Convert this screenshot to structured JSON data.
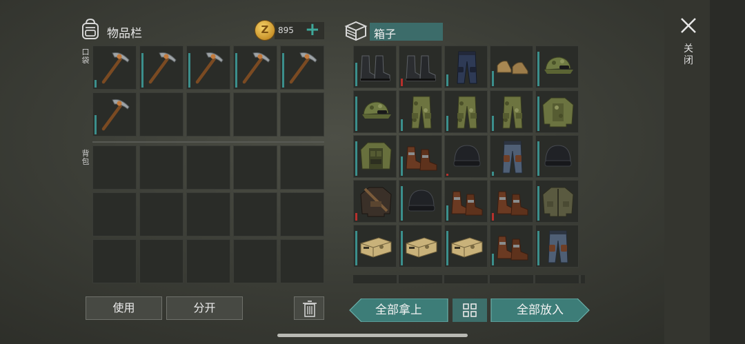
{
  "inventory": {
    "title": "物品栏",
    "pocket_label": "口袋",
    "backpack_label": "背包",
    "currency": {
      "icon": "zombie-coin-icon",
      "symbol": "Z",
      "amount": "895",
      "add_icon": "plus-icon"
    },
    "pocket_items": [
      "pickaxe",
      "pickaxe",
      "pickaxe",
      "pickaxe",
      "pickaxe",
      "pickaxe",
      "",
      "",
      "",
      ""
    ],
    "pocket_bars": [
      0.2,
      0.9,
      0.9,
      0.9,
      0.9,
      0.5,
      0,
      0,
      0,
      0
    ],
    "backpack_items": [
      "",
      "",
      "",
      "",
      "",
      "",
      "",
      "",
      "",
      "",
      "",
      "",
      "",
      "",
      ""
    ]
  },
  "container": {
    "title": "箱子",
    "items": [
      "boots-black",
      "boots-black",
      "pants-blue",
      "shoes-tan",
      "cap-camo",
      "cap-camo",
      "pants-camo",
      "pants-camo",
      "pants-camo",
      "jacket-camo",
      "vest-camo",
      "boots-brown",
      "beanie-black",
      "pants-armored",
      "beanie-black",
      "jacket-leather",
      "beanie-black",
      "boots-brown",
      "boots-brown",
      "jacket-olive",
      "crate-tan",
      "crate-tan",
      "crate-tan",
      "boots-brown",
      "pants-armored"
    ],
    "bars": [
      {
        "level": 0.6,
        "color": "#3b8f8c"
      },
      {
        "level": 0.2,
        "color": "#b6302c"
      },
      {
        "level": 0.3,
        "color": "#3b8f8c"
      },
      {
        "level": 0.4,
        "color": "#3b8f8c"
      },
      {
        "level": 0.9,
        "color": "#3b8f8c"
      },
      {
        "level": 0.9,
        "color": "#3b8f8c"
      },
      {
        "level": 0.3,
        "color": "#3b8f8c"
      },
      {
        "level": 0.4,
        "color": "#3b8f8c"
      },
      {
        "level": 0.4,
        "color": "#3b8f8c"
      },
      {
        "level": 0.9,
        "color": "#3b8f8c"
      },
      {
        "level": 0.9,
        "color": "#3b8f8c"
      },
      {
        "level": 0.5,
        "color": "#3b8f8c"
      },
      {
        "level": 0.06,
        "color": "#b6302c"
      },
      {
        "level": 0.1,
        "color": "#3b8f8c"
      },
      {
        "level": 0.9,
        "color": "#3b8f8c"
      },
      {
        "level": 0.2,
        "color": "#b6302c"
      },
      {
        "level": 0.9,
        "color": "#3b8f8c"
      },
      {
        "level": 0.4,
        "color": "#3b8f8c"
      },
      {
        "level": 0.2,
        "color": "#b6302c"
      },
      {
        "level": 0.9,
        "color": "#3b8f8c"
      },
      {
        "level": 0.9,
        "color": "#3b8f8c"
      },
      {
        "level": 0.9,
        "color": "#3b8f8c"
      },
      {
        "level": 0.9,
        "color": "#3b8f8c"
      },
      {
        "level": 0.3,
        "color": "#3b8f8c"
      },
      {
        "level": 0.9,
        "color": "#3b8f8c"
      }
    ]
  },
  "buttons": {
    "use": "使用",
    "split": "分开",
    "trash_icon": "trash-icon",
    "take_all": "全部拿上",
    "sort_icon": "grid-sort-icon",
    "put_all": "全部放入"
  },
  "close": {
    "icon": "close-icon",
    "label": "关闭"
  },
  "colors": {
    "accent_teal": "#3d7d78",
    "durability": "#3b8f8c",
    "low_durability": "#b6302c",
    "coin": "#e0a93a"
  }
}
